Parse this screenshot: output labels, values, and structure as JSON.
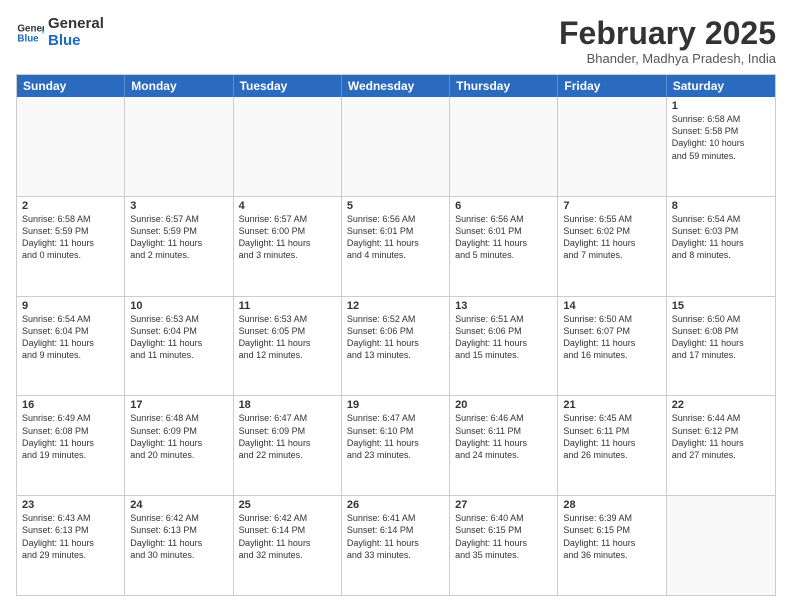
{
  "logo": {
    "line1": "General",
    "line2": "Blue"
  },
  "title": "February 2025",
  "location": "Bhander, Madhya Pradesh, India",
  "days_of_week": [
    "Sunday",
    "Monday",
    "Tuesday",
    "Wednesday",
    "Thursday",
    "Friday",
    "Saturday"
  ],
  "weeks": [
    [
      {
        "day": "",
        "info": ""
      },
      {
        "day": "",
        "info": ""
      },
      {
        "day": "",
        "info": ""
      },
      {
        "day": "",
        "info": ""
      },
      {
        "day": "",
        "info": ""
      },
      {
        "day": "",
        "info": ""
      },
      {
        "day": "1",
        "info": "Sunrise: 6:58 AM\nSunset: 5:58 PM\nDaylight: 10 hours\nand 59 minutes."
      }
    ],
    [
      {
        "day": "2",
        "info": "Sunrise: 6:58 AM\nSunset: 5:59 PM\nDaylight: 11 hours\nand 0 minutes."
      },
      {
        "day": "3",
        "info": "Sunrise: 6:57 AM\nSunset: 5:59 PM\nDaylight: 11 hours\nand 2 minutes."
      },
      {
        "day": "4",
        "info": "Sunrise: 6:57 AM\nSunset: 6:00 PM\nDaylight: 11 hours\nand 3 minutes."
      },
      {
        "day": "5",
        "info": "Sunrise: 6:56 AM\nSunset: 6:01 PM\nDaylight: 11 hours\nand 4 minutes."
      },
      {
        "day": "6",
        "info": "Sunrise: 6:56 AM\nSunset: 6:01 PM\nDaylight: 11 hours\nand 5 minutes."
      },
      {
        "day": "7",
        "info": "Sunrise: 6:55 AM\nSunset: 6:02 PM\nDaylight: 11 hours\nand 7 minutes."
      },
      {
        "day": "8",
        "info": "Sunrise: 6:54 AM\nSunset: 6:03 PM\nDaylight: 11 hours\nand 8 minutes."
      }
    ],
    [
      {
        "day": "9",
        "info": "Sunrise: 6:54 AM\nSunset: 6:04 PM\nDaylight: 11 hours\nand 9 minutes."
      },
      {
        "day": "10",
        "info": "Sunrise: 6:53 AM\nSunset: 6:04 PM\nDaylight: 11 hours\nand 11 minutes."
      },
      {
        "day": "11",
        "info": "Sunrise: 6:53 AM\nSunset: 6:05 PM\nDaylight: 11 hours\nand 12 minutes."
      },
      {
        "day": "12",
        "info": "Sunrise: 6:52 AM\nSunset: 6:06 PM\nDaylight: 11 hours\nand 13 minutes."
      },
      {
        "day": "13",
        "info": "Sunrise: 6:51 AM\nSunset: 6:06 PM\nDaylight: 11 hours\nand 15 minutes."
      },
      {
        "day": "14",
        "info": "Sunrise: 6:50 AM\nSunset: 6:07 PM\nDaylight: 11 hours\nand 16 minutes."
      },
      {
        "day": "15",
        "info": "Sunrise: 6:50 AM\nSunset: 6:08 PM\nDaylight: 11 hours\nand 17 minutes."
      }
    ],
    [
      {
        "day": "16",
        "info": "Sunrise: 6:49 AM\nSunset: 6:08 PM\nDaylight: 11 hours\nand 19 minutes."
      },
      {
        "day": "17",
        "info": "Sunrise: 6:48 AM\nSunset: 6:09 PM\nDaylight: 11 hours\nand 20 minutes."
      },
      {
        "day": "18",
        "info": "Sunrise: 6:47 AM\nSunset: 6:09 PM\nDaylight: 11 hours\nand 22 minutes."
      },
      {
        "day": "19",
        "info": "Sunrise: 6:47 AM\nSunset: 6:10 PM\nDaylight: 11 hours\nand 23 minutes."
      },
      {
        "day": "20",
        "info": "Sunrise: 6:46 AM\nSunset: 6:11 PM\nDaylight: 11 hours\nand 24 minutes."
      },
      {
        "day": "21",
        "info": "Sunrise: 6:45 AM\nSunset: 6:11 PM\nDaylight: 11 hours\nand 26 minutes."
      },
      {
        "day": "22",
        "info": "Sunrise: 6:44 AM\nSunset: 6:12 PM\nDaylight: 11 hours\nand 27 minutes."
      }
    ],
    [
      {
        "day": "23",
        "info": "Sunrise: 6:43 AM\nSunset: 6:13 PM\nDaylight: 11 hours\nand 29 minutes."
      },
      {
        "day": "24",
        "info": "Sunrise: 6:42 AM\nSunset: 6:13 PM\nDaylight: 11 hours\nand 30 minutes."
      },
      {
        "day": "25",
        "info": "Sunrise: 6:42 AM\nSunset: 6:14 PM\nDaylight: 11 hours\nand 32 minutes."
      },
      {
        "day": "26",
        "info": "Sunrise: 6:41 AM\nSunset: 6:14 PM\nDaylight: 11 hours\nand 33 minutes."
      },
      {
        "day": "27",
        "info": "Sunrise: 6:40 AM\nSunset: 6:15 PM\nDaylight: 11 hours\nand 35 minutes."
      },
      {
        "day": "28",
        "info": "Sunrise: 6:39 AM\nSunset: 6:15 PM\nDaylight: 11 hours\nand 36 minutes."
      },
      {
        "day": "",
        "info": ""
      }
    ]
  ]
}
